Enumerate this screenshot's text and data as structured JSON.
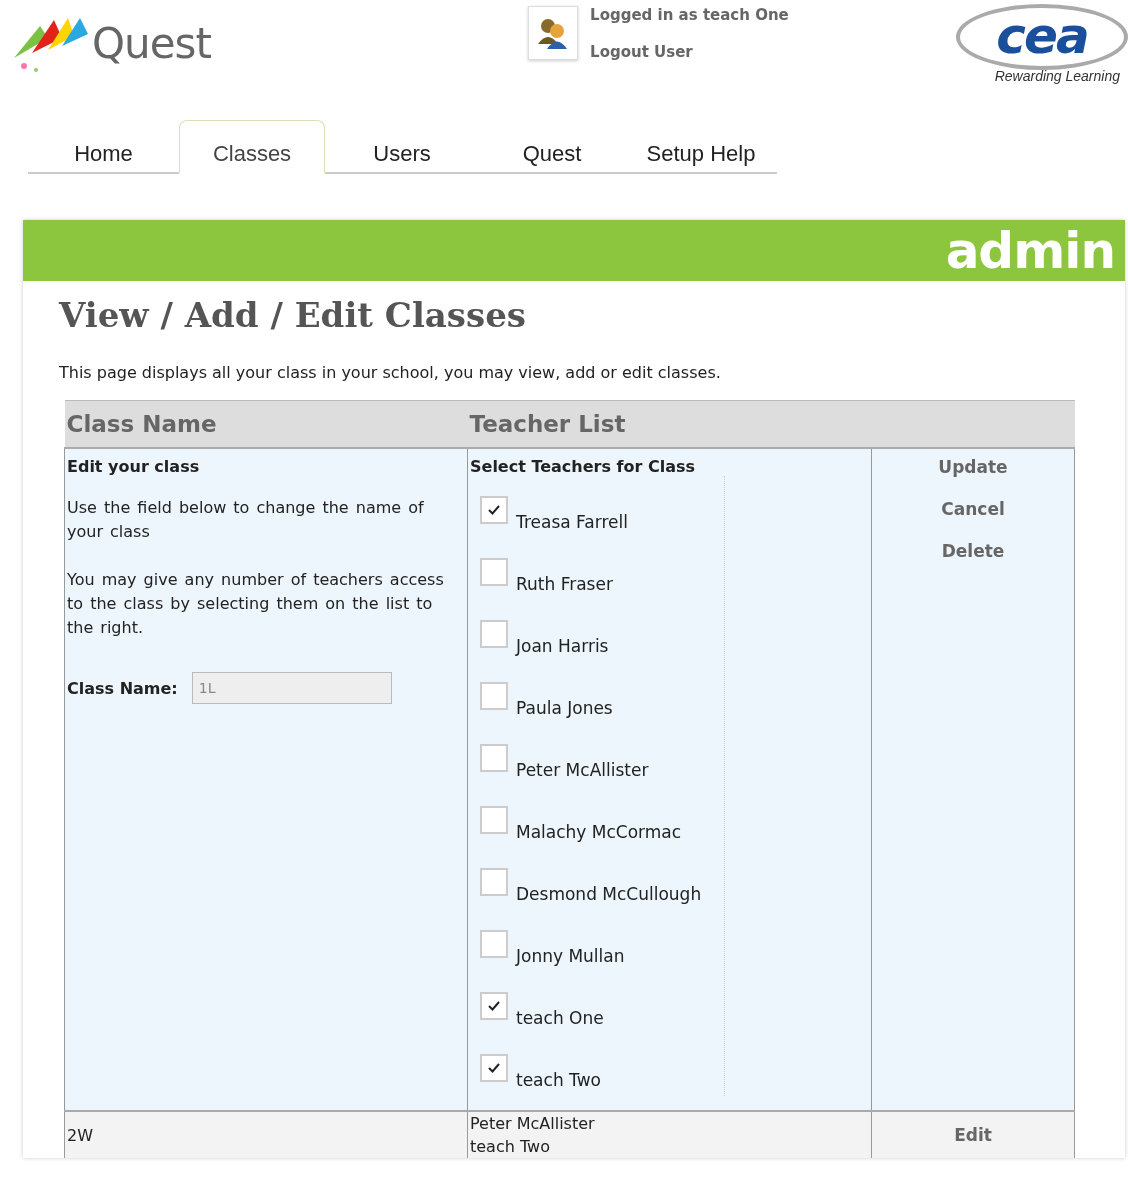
{
  "header": {
    "logo_text": "Quest",
    "user_status": "Logged in as teach One",
    "logout_link": "Logout User",
    "partner_logo_text": "cea",
    "partner_tagline": "Rewarding Learning"
  },
  "tabs": [
    {
      "label": "Home",
      "selected": false
    },
    {
      "label": "Classes",
      "selected": true
    },
    {
      "label": "Users",
      "selected": false
    },
    {
      "label": "Quest",
      "selected": false
    },
    {
      "label": "Setup Help",
      "selected": false
    }
  ],
  "banner": {
    "title": "admin"
  },
  "page": {
    "heading": "View / Add / Edit Classes",
    "description": "This page displays all your class in your school, you may view, add or edit classes."
  },
  "table": {
    "columns": [
      "Class Name",
      "Teacher List"
    ],
    "edit_row": {
      "heading": "Edit your class",
      "help_text": [
        "Use the field below to change the name of your class",
        "You may give any number of teachers access to the class by selecting them on the list to the right."
      ],
      "field_label": "Class Name:",
      "field_value": "1L",
      "teachers_heading": "Select Teachers for Class",
      "teachers": [
        {
          "name": "Treasa Farrell",
          "checked": true
        },
        {
          "name": "Ruth Fraser",
          "checked": false
        },
        {
          "name": "Joan Harris",
          "checked": false
        },
        {
          "name": "Paula Jones",
          "checked": false
        },
        {
          "name": "Peter McAllister",
          "checked": false
        },
        {
          "name": "Malachy McCormac",
          "checked": false
        },
        {
          "name": "Desmond McCullough",
          "checked": false
        },
        {
          "name": "Jonny Mullan",
          "checked": false
        },
        {
          "name": "teach One",
          "checked": true
        },
        {
          "name": "teach Two",
          "checked": true
        }
      ],
      "actions": [
        "Update",
        "Cancel",
        "Delete"
      ]
    },
    "rows": [
      {
        "class_name": "2W",
        "teachers": [
          "Peter McAllister",
          "teach Two"
        ],
        "action": "Edit"
      }
    ]
  }
}
